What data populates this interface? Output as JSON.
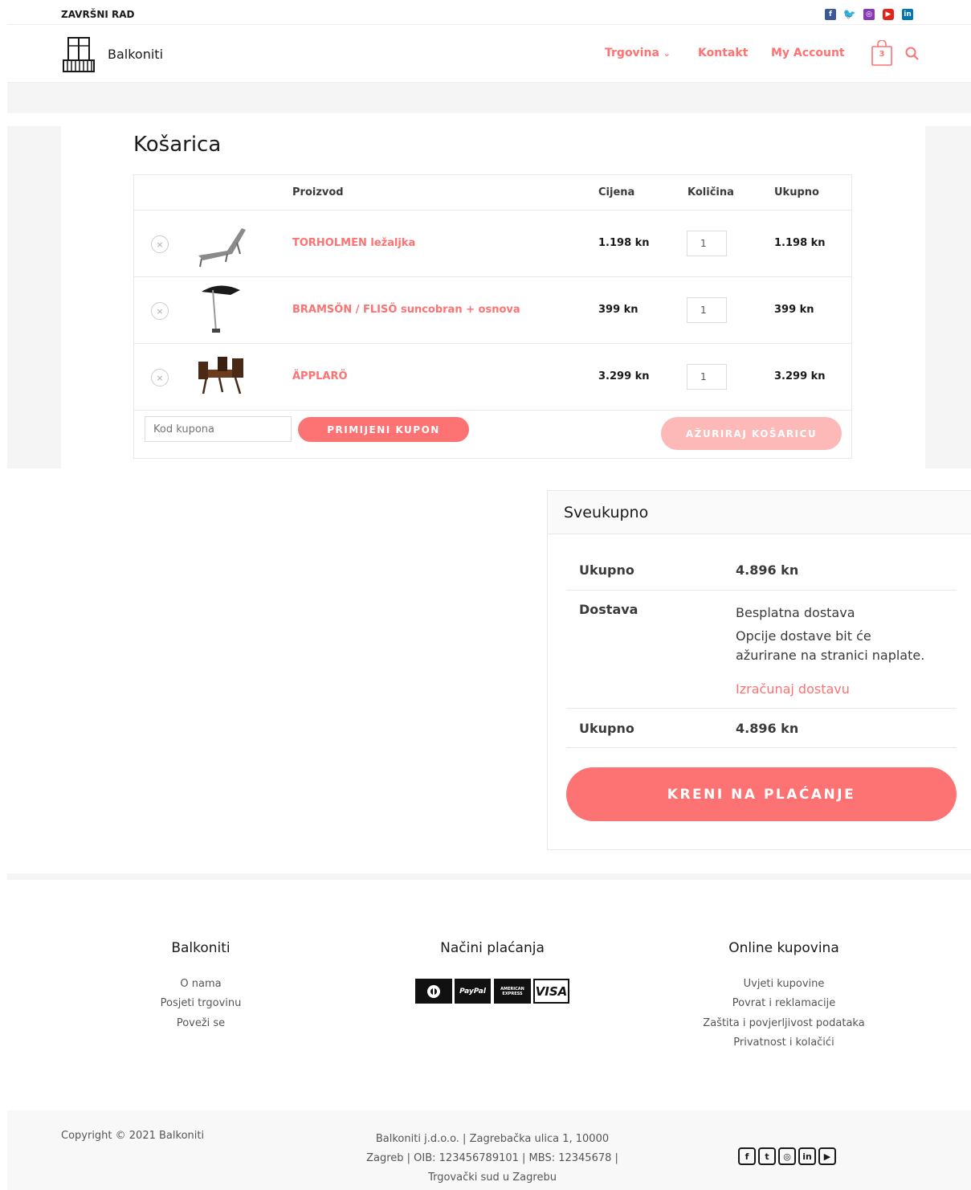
{
  "topbar": {
    "title": "ZAVRŠNI RAD"
  },
  "header": {
    "brand": "Balkoniti",
    "nav": [
      "Trgovina",
      "Kontakt",
      "My Account"
    ],
    "nav_chevron": "⌄",
    "cart_count": "3"
  },
  "cart": {
    "title": "Košarica",
    "columns": [
      "Proizvod",
      "Cijena",
      "Količina",
      "Ukupno"
    ],
    "items": [
      {
        "name": "TORHOLMEN ležaljka",
        "price": "1.198 kn",
        "qty": "1",
        "total": "1.198 kn"
      },
      {
        "name": "BRAMSÖN / FLISÖ suncobran + osnova",
        "price": "399 kn",
        "qty": "1",
        "total": "399 kn"
      },
      {
        "name": "ÄPPLARÖ",
        "price": "3.299 kn",
        "qty": "1",
        "total": "3.299 kn"
      }
    ],
    "coupon_placeholder": "Kod kupona",
    "apply_coupon": "PRIMIJENI KUPON",
    "update_cart": "AŽURIRAJ KOŠARICU",
    "remove_glyph": "×"
  },
  "totals": {
    "title": "Sveukupno",
    "subtotal_label": "Ukupno",
    "subtotal_value": "4.896 kn",
    "shipping_label": "Dostava",
    "shipping_value": "Besplatna dostava",
    "shipping_note_1": "Opcije dostave bit će",
    "shipping_note_2": "ažurirane na stranici naplate.",
    "calc_shipping": "Izračunaj dostavu",
    "total_label": "Ukupno",
    "total_value": "4.896 kn",
    "checkout": "KRENI NA PLAĆANJE"
  },
  "footer": {
    "col1_title": "Balkoniti",
    "col1_links": [
      "O nama",
      "Posjeti trgovinu",
      "Poveži se"
    ],
    "col2_title": "Načini plaćanja",
    "payment_labels": [
      "PayPal",
      "AMERICAN EXPRESS",
      "VISA"
    ],
    "col3_title": "Online kupovina",
    "col3_links": [
      "Uvjeti kupovine",
      "Povrat i reklamacije",
      "Zaštita i povjerljivost podataka",
      "Privatnost i kolačići"
    ],
    "copyright": "Copyright © 2021 Balkoniti",
    "company_1": "Balkoniti j.d.o.o. | Zagrebačka ulica 1, 10000",
    "company_2": "Zagreb | OIB: 123456789101 | MBS: 12345678 |",
    "company_3": "Trgovački sud u Zagrebu"
  },
  "social_icons": [
    "facebook-icon",
    "twitter-icon",
    "instagram-icon",
    "youtube-icon",
    "linkedin-icon"
  ],
  "colors": {
    "accent": "#fd7272",
    "accent_light": "#fdb8b8"
  }
}
